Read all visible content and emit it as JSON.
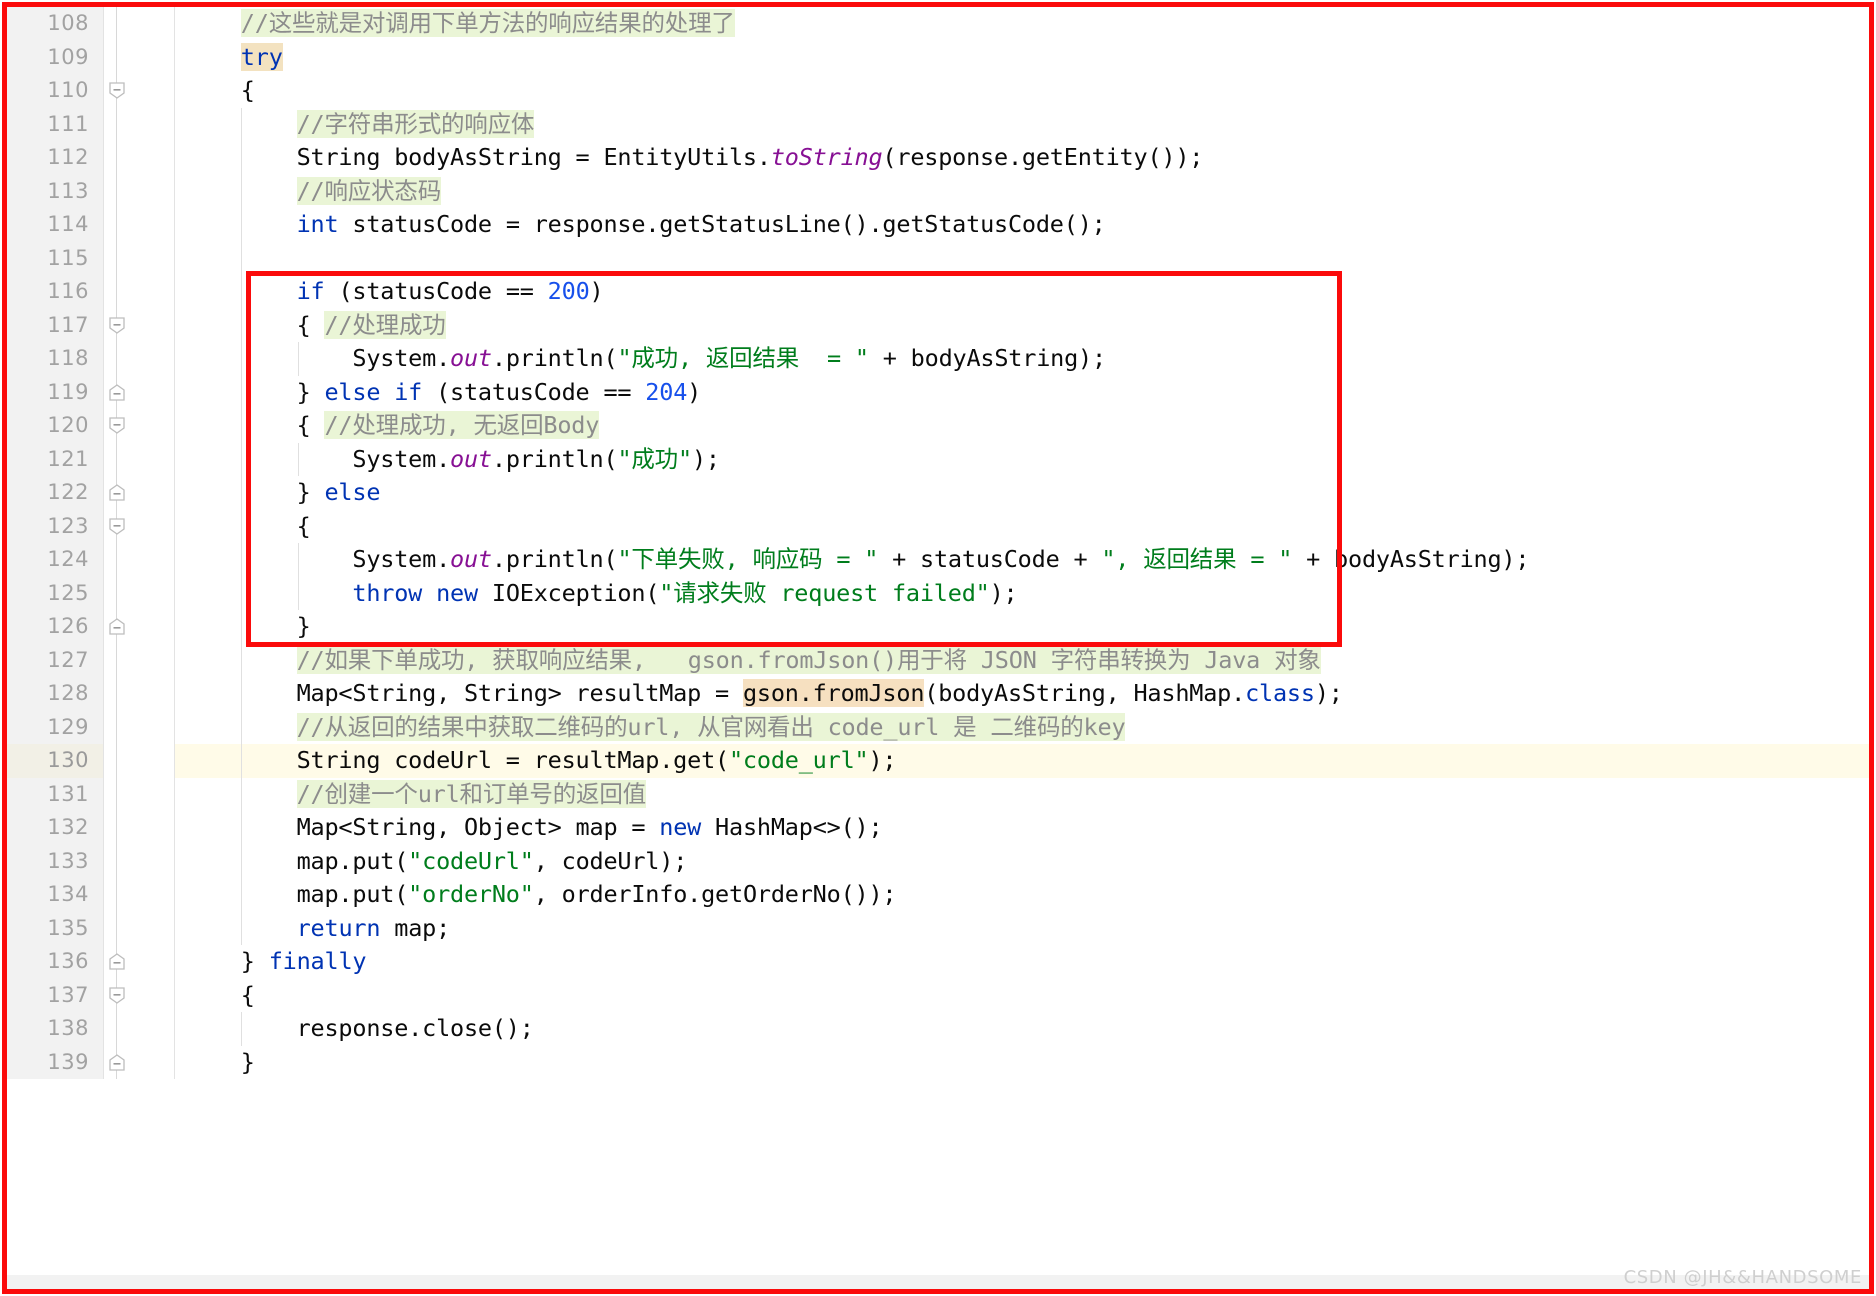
{
  "app": {
    "kind": "code-editor",
    "language": "Java",
    "watermark": "CSDN @JH&&HANDSOME",
    "accent_annotation_color": "#fb0b0b",
    "gutter_bg": "#f2f2f2",
    "comment_highlight_color": "#eaf5d6",
    "current_line_color": "#fffbe8",
    "search_highlight_color": "#f6e0c0"
  },
  "annotations": {
    "outer_box_label": "outer-red-border",
    "inner_box_label": "if-else-status-code-block"
  },
  "editor": {
    "first_line": 108,
    "last_line": 139,
    "current_line": 130,
    "lines": [
      {
        "no": "108",
        "fold": "",
        "indent_guides": [
          0
        ],
        "tokens": [
          {
            "t": "    ",
            "c": "plain"
          },
          {
            "t": "//这些就是对调用下单方法的响应结果的处理了",
            "c": "cmt"
          }
        ]
      },
      {
        "no": "109",
        "fold": "",
        "indent_guides": [
          0
        ],
        "tokens": [
          {
            "t": "    ",
            "c": "plain"
          },
          {
            "t": "try",
            "c": "kw hl-try"
          }
        ]
      },
      {
        "no": "110",
        "fold": "minus-down",
        "indent_guides": [
          0
        ],
        "tokens": [
          {
            "t": "    {",
            "c": "plain"
          }
        ]
      },
      {
        "no": "111",
        "fold": "",
        "indent_guides": [
          0,
          1
        ],
        "tokens": [
          {
            "t": "        ",
            "c": "plain"
          },
          {
            "t": "//字符串形式的响应体",
            "c": "cmt"
          }
        ]
      },
      {
        "no": "112",
        "fold": "",
        "indent_guides": [
          0,
          1
        ],
        "tokens": [
          {
            "t": "        String bodyAsString = EntityUtils.",
            "c": "plain"
          },
          {
            "t": "toString",
            "c": "fld"
          },
          {
            "t": "(response.getEntity());",
            "c": "plain"
          }
        ]
      },
      {
        "no": "113",
        "fold": "",
        "indent_guides": [
          0,
          1
        ],
        "tokens": [
          {
            "t": "        ",
            "c": "plain"
          },
          {
            "t": "//响应状态码",
            "c": "cmt"
          }
        ]
      },
      {
        "no": "114",
        "fold": "",
        "indent_guides": [
          0,
          1
        ],
        "tokens": [
          {
            "t": "        ",
            "c": "plain"
          },
          {
            "t": "int",
            "c": "kw"
          },
          {
            "t": " statusCode = response.getStatusLine().getStatusCode();",
            "c": "plain"
          }
        ]
      },
      {
        "no": "115",
        "fold": "",
        "indent_guides": [
          0,
          1
        ],
        "tokens": []
      },
      {
        "no": "116",
        "fold": "",
        "indent_guides": [
          0,
          1
        ],
        "tokens": [
          {
            "t": "        ",
            "c": "plain"
          },
          {
            "t": "if",
            "c": "kw"
          },
          {
            "t": " (statusCode == ",
            "c": "plain"
          },
          {
            "t": "200",
            "c": "num"
          },
          {
            "t": ")",
            "c": "plain"
          }
        ]
      },
      {
        "no": "117",
        "fold": "minus-down",
        "indent_guides": [
          0,
          1
        ],
        "tokens": [
          {
            "t": "        { ",
            "c": "plain"
          },
          {
            "t": "//处理成功",
            "c": "cmt"
          }
        ]
      },
      {
        "no": "118",
        "fold": "",
        "indent_guides": [
          0,
          1,
          2
        ],
        "tokens": [
          {
            "t": "            System.",
            "c": "plain"
          },
          {
            "t": "out",
            "c": "fld"
          },
          {
            "t": ".println(",
            "c": "plain"
          },
          {
            "t": "\"成功, 返回结果  = \"",
            "c": "str"
          },
          {
            "t": " + bodyAsString);",
            "c": "plain"
          }
        ]
      },
      {
        "no": "119",
        "fold": "minus-up",
        "indent_guides": [
          0,
          1
        ],
        "tokens": [
          {
            "t": "        } ",
            "c": "plain"
          },
          {
            "t": "else if",
            "c": "kw"
          },
          {
            "t": " (statusCode == ",
            "c": "plain"
          },
          {
            "t": "204",
            "c": "num"
          },
          {
            "t": ")",
            "c": "plain"
          }
        ]
      },
      {
        "no": "120",
        "fold": "minus-down",
        "indent_guides": [
          0,
          1
        ],
        "tokens": [
          {
            "t": "        { ",
            "c": "plain"
          },
          {
            "t": "//处理成功, 无返回Body",
            "c": "cmt"
          }
        ]
      },
      {
        "no": "121",
        "fold": "",
        "indent_guides": [
          0,
          1,
          2
        ],
        "tokens": [
          {
            "t": "            System.",
            "c": "plain"
          },
          {
            "t": "out",
            "c": "fld"
          },
          {
            "t": ".println(",
            "c": "plain"
          },
          {
            "t": "\"成功\"",
            "c": "str"
          },
          {
            "t": ");",
            "c": "plain"
          }
        ]
      },
      {
        "no": "122",
        "fold": "minus-up",
        "indent_guides": [
          0,
          1
        ],
        "tokens": [
          {
            "t": "        } ",
            "c": "plain"
          },
          {
            "t": "else",
            "c": "kw"
          }
        ]
      },
      {
        "no": "123",
        "fold": "minus-down",
        "indent_guides": [
          0,
          1
        ],
        "tokens": [
          {
            "t": "        {",
            "c": "plain"
          }
        ]
      },
      {
        "no": "124",
        "fold": "",
        "indent_guides": [
          0,
          1,
          2
        ],
        "tokens": [
          {
            "t": "            System.",
            "c": "plain"
          },
          {
            "t": "out",
            "c": "fld"
          },
          {
            "t": ".println(",
            "c": "plain"
          },
          {
            "t": "\"下单失败, 响应码 = \"",
            "c": "str"
          },
          {
            "t": " + statusCode + ",
            "c": "plain"
          },
          {
            "t": "\", 返回结果 = \"",
            "c": "str"
          },
          {
            "t": " + bodyAsString);",
            "c": "plain"
          }
        ]
      },
      {
        "no": "125",
        "fold": "",
        "indent_guides": [
          0,
          1,
          2
        ],
        "tokens": [
          {
            "t": "            ",
            "c": "plain"
          },
          {
            "t": "throw new",
            "c": "kw"
          },
          {
            "t": " IOException(",
            "c": "plain"
          },
          {
            "t": "\"请求失败 request failed\"",
            "c": "str"
          },
          {
            "t": ");",
            "c": "plain"
          }
        ]
      },
      {
        "no": "126",
        "fold": "minus-up",
        "indent_guides": [
          0,
          1
        ],
        "tokens": [
          {
            "t": "        }",
            "c": "plain"
          }
        ]
      },
      {
        "no": "127",
        "fold": "",
        "indent_guides": [
          0,
          1
        ],
        "tokens": [
          {
            "t": "        ",
            "c": "plain"
          },
          {
            "t": "//如果下单成功, 获取响应结果,   gson.fromJson()用于将 JSON 字符串转换为 Java 对象",
            "c": "cmt"
          }
        ]
      },
      {
        "no": "128",
        "fold": "",
        "indent_guides": [
          0,
          1
        ],
        "tokens": [
          {
            "t": "        Map<String, String> resultMap = ",
            "c": "plain"
          },
          {
            "t": "gson.fromJson",
            "c": "plain hl-gson"
          },
          {
            "t": "(bodyAsString, HashMap.",
            "c": "plain"
          },
          {
            "t": "class",
            "c": "kw"
          },
          {
            "t": ");",
            "c": "plain"
          }
        ]
      },
      {
        "no": "129",
        "fold": "",
        "indent_guides": [
          0,
          1
        ],
        "tokens": [
          {
            "t": "        ",
            "c": "plain"
          },
          {
            "t": "//从返回的结果中获取二维码的url, 从官网看出 code_url 是 二维码的key",
            "c": "cmt"
          }
        ]
      },
      {
        "no": "130",
        "fold": "",
        "current": true,
        "indent_guides": [
          0,
          1
        ],
        "tokens": [
          {
            "t": "        String codeUrl = resultMap.get(",
            "c": "plain"
          },
          {
            "t": "\"code_url\"",
            "c": "str"
          },
          {
            "t": ");",
            "c": "plain"
          }
        ]
      },
      {
        "no": "131",
        "fold": "",
        "indent_guides": [
          0,
          1
        ],
        "tokens": [
          {
            "t": "        ",
            "c": "plain"
          },
          {
            "t": "//创建一个url和订单号的返回值",
            "c": "cmt"
          }
        ]
      },
      {
        "no": "132",
        "fold": "",
        "indent_guides": [
          0,
          1
        ],
        "tokens": [
          {
            "t": "        Map<String, Object> map = ",
            "c": "plain"
          },
          {
            "t": "new",
            "c": "kw"
          },
          {
            "t": " HashMap<>();",
            "c": "plain"
          }
        ]
      },
      {
        "no": "133",
        "fold": "",
        "indent_guides": [
          0,
          1
        ],
        "tokens": [
          {
            "t": "        map.put(",
            "c": "plain"
          },
          {
            "t": "\"codeUrl\"",
            "c": "str"
          },
          {
            "t": ", codeUrl);",
            "c": "plain"
          }
        ]
      },
      {
        "no": "134",
        "fold": "",
        "indent_guides": [
          0,
          1
        ],
        "tokens": [
          {
            "t": "        map.put(",
            "c": "plain"
          },
          {
            "t": "\"orderNo\"",
            "c": "str"
          },
          {
            "t": ", orderInfo.getOrderNo());",
            "c": "plain"
          }
        ]
      },
      {
        "no": "135",
        "fold": "",
        "indent_guides": [
          0,
          1
        ],
        "tokens": [
          {
            "t": "        ",
            "c": "plain"
          },
          {
            "t": "return",
            "c": "kw"
          },
          {
            "t": " map;",
            "c": "plain"
          }
        ]
      },
      {
        "no": "136",
        "fold": "minus-up",
        "indent_guides": [
          0
        ],
        "tokens": [
          {
            "t": "    } ",
            "c": "plain"
          },
          {
            "t": "finally",
            "c": "kw"
          }
        ]
      },
      {
        "no": "137",
        "fold": "minus-down",
        "indent_guides": [
          0
        ],
        "tokens": [
          {
            "t": "    {",
            "c": "plain"
          }
        ]
      },
      {
        "no": "138",
        "fold": "",
        "indent_guides": [
          0,
          1
        ],
        "tokens": [
          {
            "t": "        response.close();",
            "c": "plain"
          }
        ]
      },
      {
        "no": "139",
        "fold": "minus-up",
        "indent_guides": [
          0
        ],
        "tokens": [
          {
            "t": "    }",
            "c": "plain"
          }
        ]
      }
    ]
  }
}
